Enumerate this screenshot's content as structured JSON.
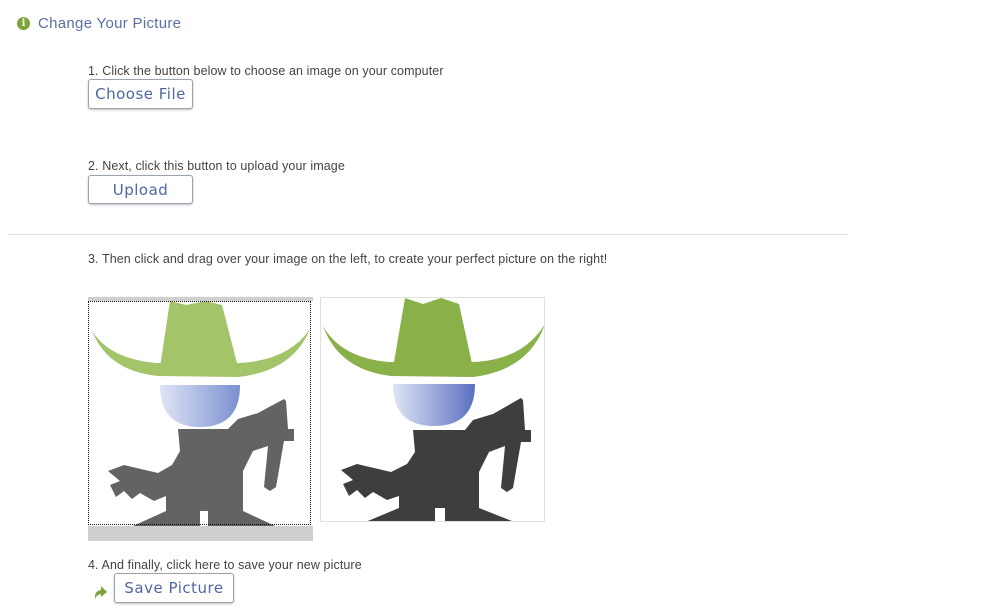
{
  "header": {
    "icon": "info-icon",
    "title": "Change Your Picture"
  },
  "steps": {
    "step1": "1. Click the button below to choose an image on your computer",
    "choose_label": "Choose File",
    "step2": "2. Next, click this button to upload your image",
    "upload_label": "Upload",
    "step3": "3. Then click and drag over your image on the left, to create your perfect picture on the right!",
    "step4": "4. And finally, click here to save your new picture",
    "save_label": "Save Picture"
  },
  "colors": {
    "accent_green": "#7ea33a",
    "link_blue": "#4f67a0",
    "hat_green_light": "#a4c46a",
    "hat_green_dark": "#8ab04a",
    "body_gray_light": "#636363",
    "body_gray_dark": "#3e3e3e"
  }
}
